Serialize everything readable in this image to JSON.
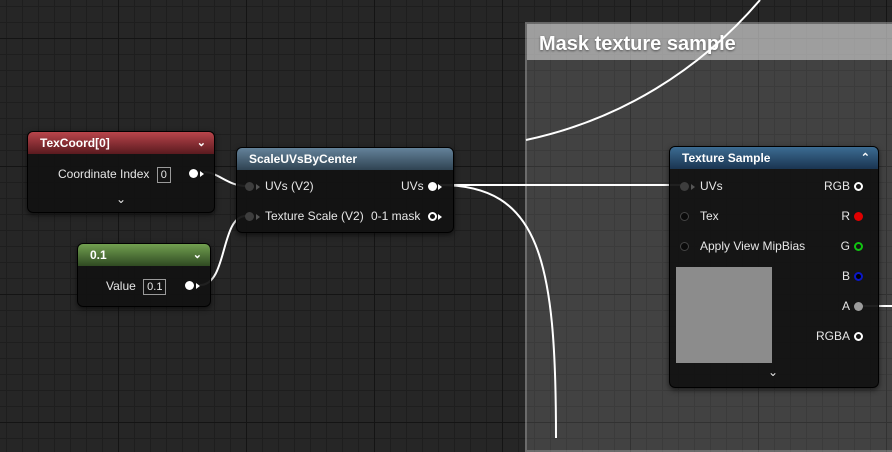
{
  "comment": {
    "title": "Mask texture sample"
  },
  "texcoord_node": {
    "title": "TexCoord[0]",
    "coordinate_index_label": "Coordinate Index",
    "coordinate_index_value": "0"
  },
  "scale_node": {
    "title": "ScaleUVsByCenter",
    "input_uvs": "UVs (V2)",
    "input_texture_scale": "Texture Scale (V2)",
    "output_uvs": "UVs",
    "output_mask": "0-1 mask"
  },
  "constant_node": {
    "title": "0.1",
    "value_label": "Value",
    "value": "0.1"
  },
  "texture_node": {
    "title": "Texture Sample",
    "inputs": [
      "UVs",
      "Tex",
      "Apply View MipBias"
    ],
    "outputs": [
      "RGB",
      "R",
      "G",
      "B",
      "A",
      "RGBA"
    ]
  },
  "colors": {
    "canvas": "#262626",
    "wire": "#ffffff",
    "pin_r": "#e00000",
    "pin_g": "#11c511",
    "pin_b": "#0b18c8"
  }
}
